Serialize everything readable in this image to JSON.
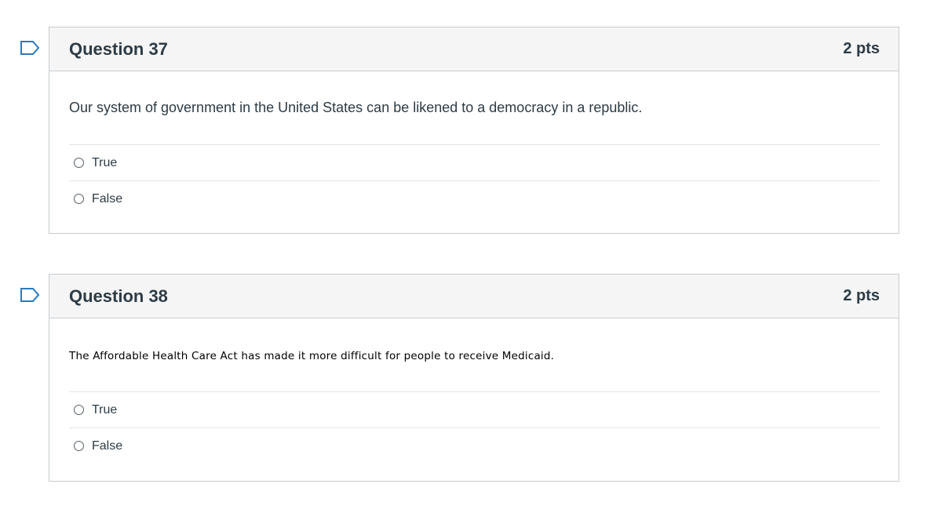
{
  "questions": [
    {
      "title": "Question 37",
      "points": "2 pts",
      "text": "Our system of government in the United States can be likened to a democracy in a republic.",
      "answers": [
        "True",
        "False"
      ]
    },
    {
      "title": "Question 38",
      "points": "2 pts",
      "text": "The Affordable Health Care Act has made it more difficult for people to receive Medicaid.",
      "answers": [
        "True",
        "False"
      ]
    }
  ],
  "colors": {
    "flag": "#2b7abc",
    "header_bg": "#f5f5f5",
    "border": "#c7cdd1"
  }
}
